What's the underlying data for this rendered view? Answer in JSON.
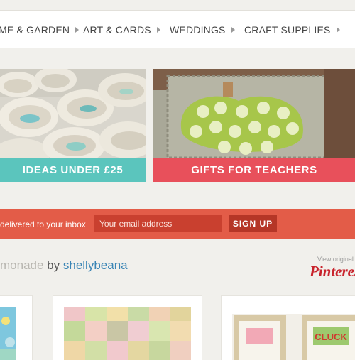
{
  "nav": {
    "items": [
      {
        "label": "ME & GARDEN"
      },
      {
        "label": "ART & CARDS"
      },
      {
        "label": "WEDDINGS"
      },
      {
        "label": "CRAFT SUPPLIES"
      }
    ]
  },
  "promos": [
    {
      "caption": "IDEAS UNDER £25",
      "color": "#5bc5bd"
    },
    {
      "caption": "GIFTS FOR TEACHERS",
      "color": "#e8505b"
    }
  ],
  "newsletter": {
    "text": "delivered to your inbox",
    "placeholder": "Your email address",
    "button": "SIGN UP",
    "bar_color": "#e35c48"
  },
  "board": {
    "title_partial": "monade",
    "by": "by",
    "user": "shellybeana",
    "view_original": "View original",
    "brand": "Pinteres"
  },
  "cards": [
    {
      "image": "blue-craft-photo"
    },
    {
      "image": "patchwork-quilt-photo"
    },
    {
      "image": "framed-cluck-art-photo",
      "sign_text": "CLUCK"
    }
  ]
}
